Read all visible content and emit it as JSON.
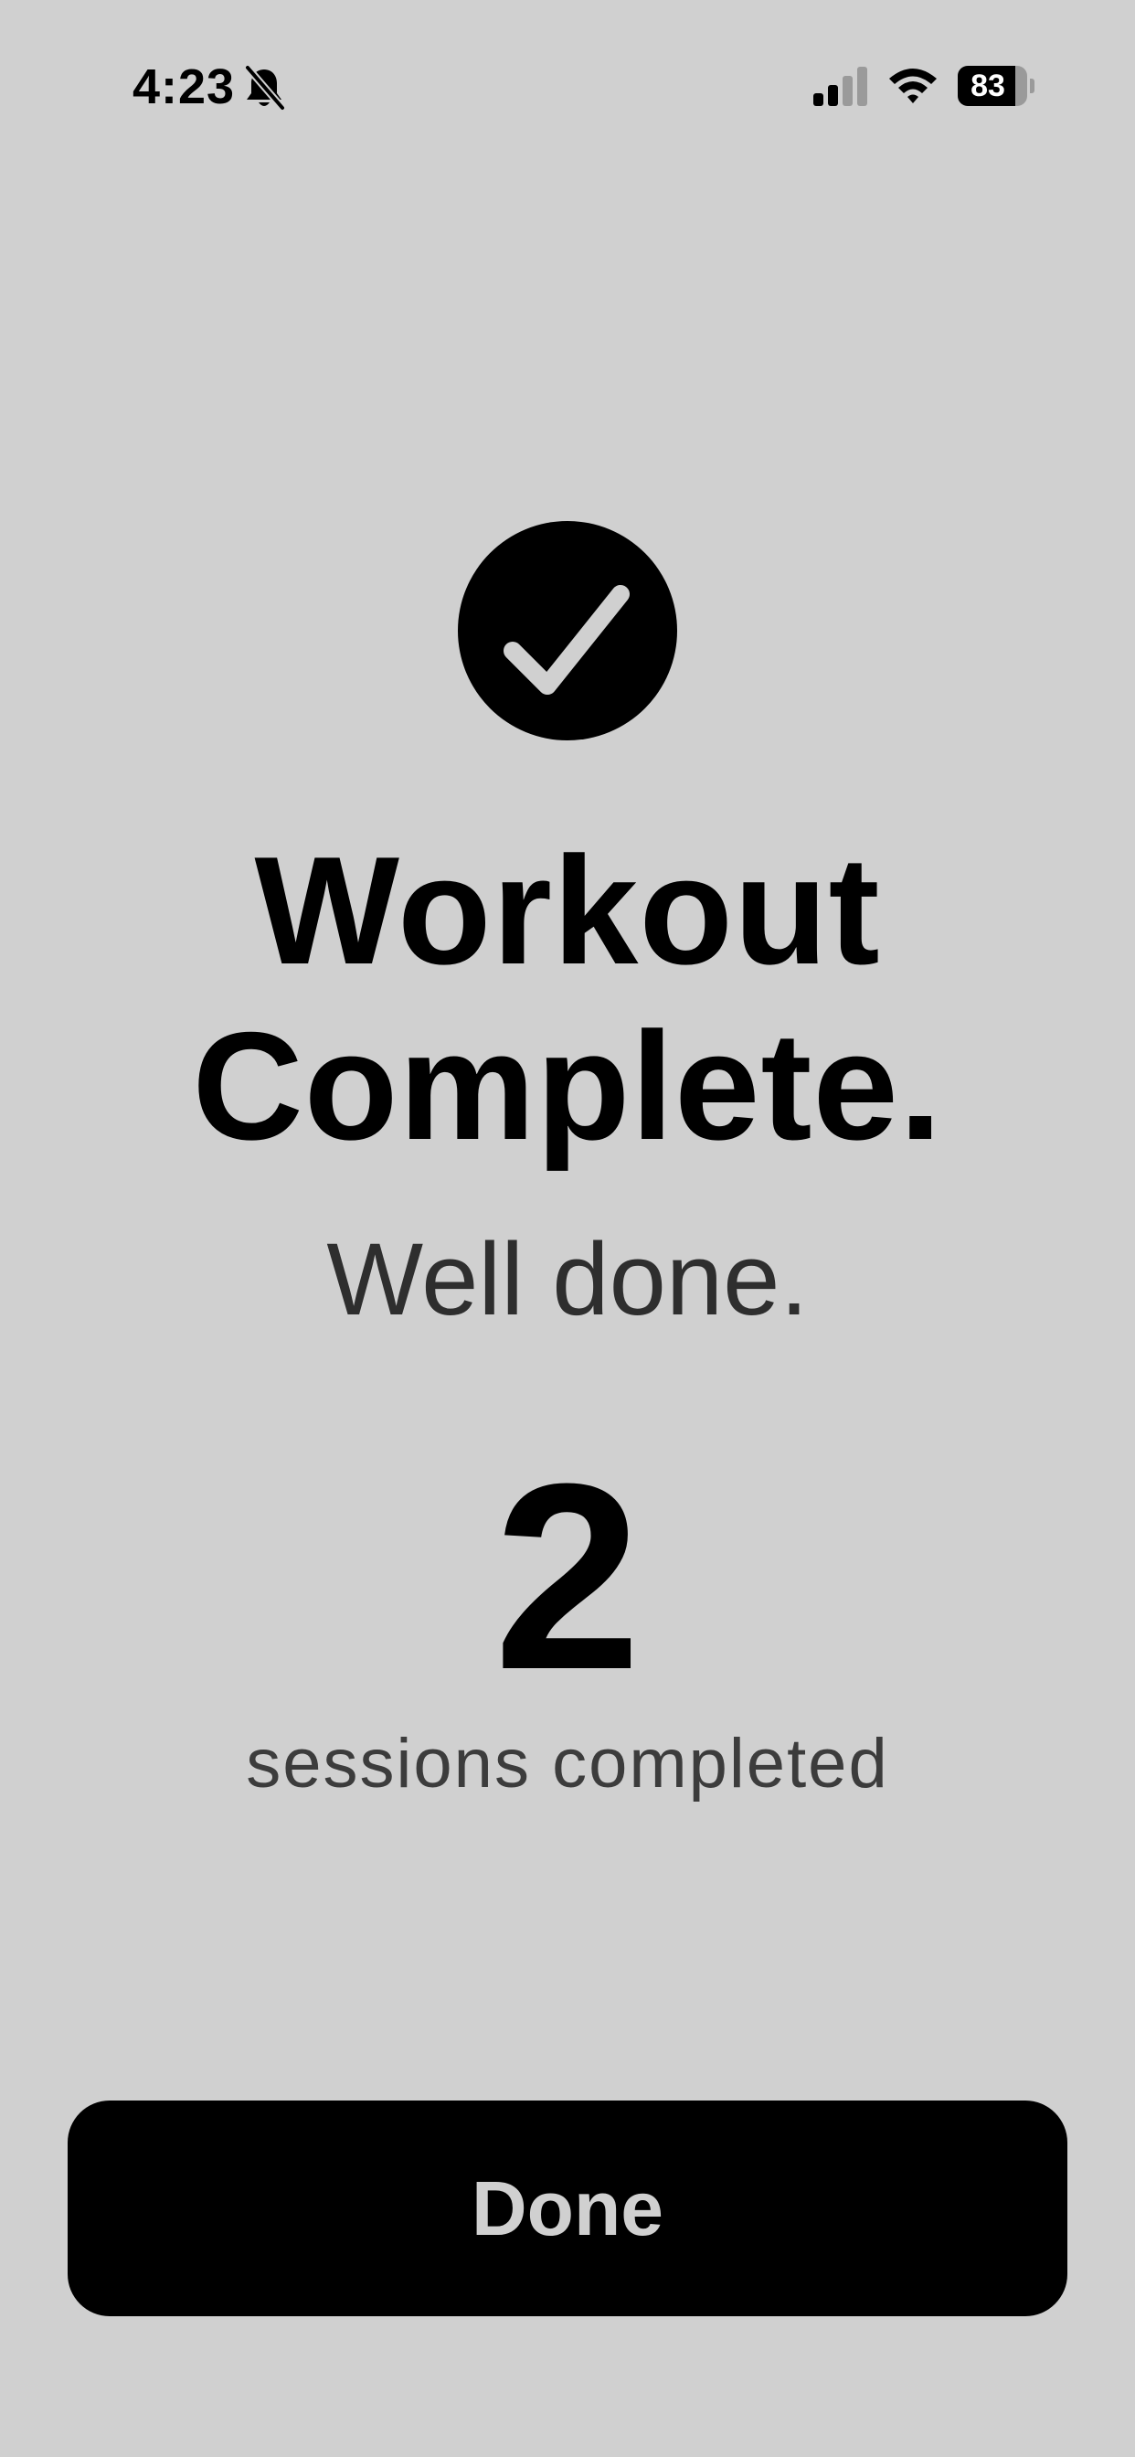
{
  "status_bar": {
    "time": "4:23",
    "icons": [
      "bell-slash-icon",
      "cellular-signal-icon",
      "wifi-icon",
      "battery-icon"
    ],
    "battery_percent": "83",
    "battery_level": 0.83,
    "signal_bars_active": 2,
    "signal_bars_total": 4
  },
  "main": {
    "icon": "checkmark-circle-icon",
    "title_line1": "Workout",
    "title_line2": "Complete.",
    "subtitle": "Well done.",
    "session_count": "2",
    "session_label": "sessions completed"
  },
  "footer": {
    "done_label": "Done"
  },
  "colors": {
    "background": "#d0d0d0",
    "foreground": "#000000",
    "button": "#000000",
    "button_text": "#d0d0d0"
  }
}
